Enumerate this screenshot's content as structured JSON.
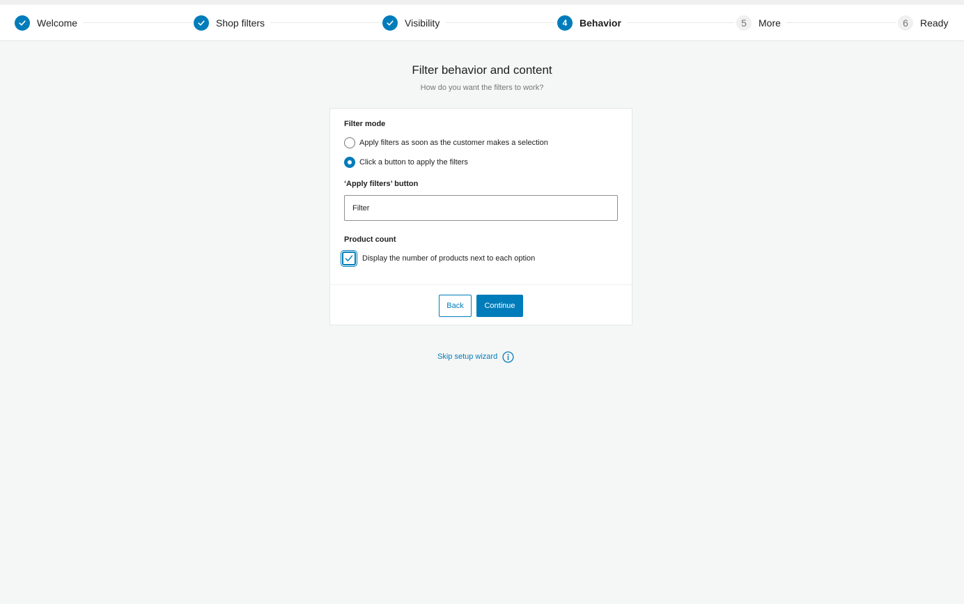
{
  "stepper": {
    "steps": [
      {
        "number": "",
        "label": "Welcome",
        "state": "done"
      },
      {
        "number": "",
        "label": "Shop filters",
        "state": "done"
      },
      {
        "number": "",
        "label": "Visibility",
        "state": "done"
      },
      {
        "number": "4",
        "label": "Behavior",
        "state": "active"
      },
      {
        "number": "5",
        "label": "More",
        "state": "todo"
      },
      {
        "number": "6",
        "label": "Ready",
        "state": "todo"
      }
    ]
  },
  "header": {
    "title": "Filter behavior and content",
    "subtitle": "How do you want the filters to work?"
  },
  "form": {
    "filter_mode": {
      "label": "Filter mode",
      "options": [
        {
          "label": "Apply filters as soon as the customer makes a selection",
          "checked": false
        },
        {
          "label": "Click a button to apply the filters",
          "checked": true
        }
      ]
    },
    "apply_button": {
      "label": "‘Apply filters’ button",
      "value": "Filter"
    },
    "product_count": {
      "label": "Product count",
      "checkbox_label": "Display the number of products next to each option",
      "checked": true
    }
  },
  "footer": {
    "back_label": "Back",
    "continue_label": "Continue"
  },
  "skip": {
    "label": "Skip setup wizard"
  },
  "colors": {
    "accent": "#007cba",
    "background": "#f5f6f6"
  }
}
